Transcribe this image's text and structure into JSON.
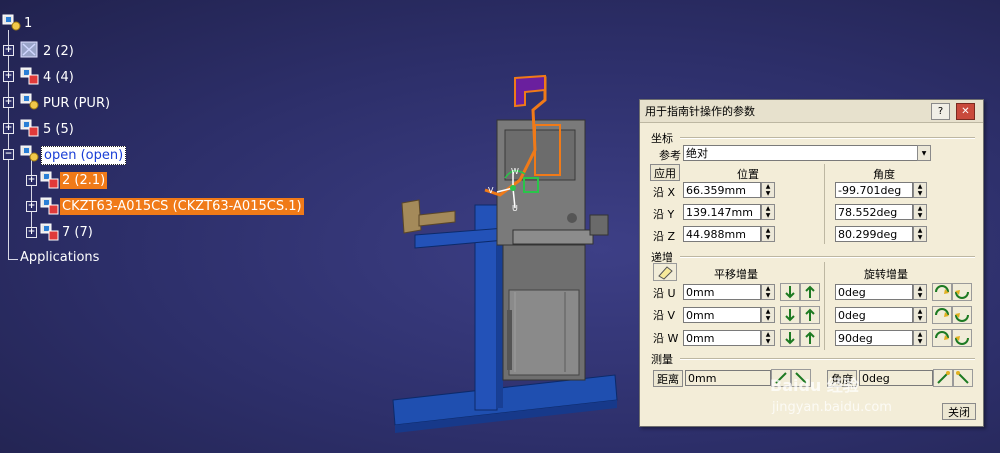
{
  "tree": {
    "root": "1",
    "items": [
      {
        "label": "2 (2)"
      },
      {
        "label": "4 (4)"
      },
      {
        "label": "PUR (PUR)"
      },
      {
        "label": "5 (5)"
      },
      {
        "label": "open (open)"
      },
      {
        "label": "2 (2.1)"
      },
      {
        "label": "CKZT63-A015CS (CKZT63-A015CS.1)"
      },
      {
        "label": "7 (7)"
      },
      {
        "label": "Applications"
      }
    ]
  },
  "compass": {
    "w": "W",
    "v": "V",
    "u": "U"
  },
  "dialog": {
    "title": "用于指南针操作的参数",
    "help_btn": "?",
    "close_btn": "✕",
    "coords": {
      "section": "坐标",
      "ref_label": "参考",
      "ref_value": "绝对",
      "apply": "应用",
      "pos_header": "位置",
      "angle_header": "角度",
      "rows": [
        {
          "axis": "沿 X",
          "pos": "66.359mm",
          "angle": "-99.701deg"
        },
        {
          "axis": "沿 Y",
          "pos": "139.147mm",
          "angle": "78.552deg"
        },
        {
          "axis": "沿 Z",
          "pos": "44.988mm",
          "angle": "80.299deg"
        }
      ]
    },
    "increment": {
      "section": "递增",
      "trans_header": "平移增量",
      "rot_header": "旋转增量",
      "rows": [
        {
          "axis": "沿 U",
          "trans": "0mm",
          "rot": "0deg"
        },
        {
          "axis": "沿 V",
          "trans": "0mm",
          "rot": "0deg"
        },
        {
          "axis": "沿 W",
          "trans": "0mm",
          "rot": "90deg"
        }
      ]
    },
    "measure": {
      "section": "测量",
      "dist_btn": "距离",
      "dist_value": "0mm",
      "angle_btn": "角度",
      "angle_value": "0deg"
    },
    "close": "关闭"
  },
  "watermark": {
    "logo": "Baidu 经验",
    "url": "jingyan.baidu.com"
  },
  "colors": {
    "accent": "#f07a18",
    "background": "#2d2f6a",
    "dialog": "#f3edd8"
  }
}
